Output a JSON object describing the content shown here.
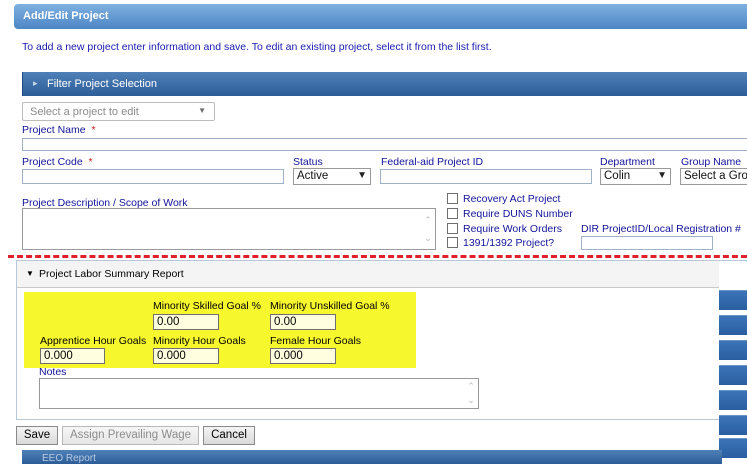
{
  "header": {
    "title": "Add/Edit Project"
  },
  "intro_text": "To add a new project enter information and save. To edit an existing project, select it from the list first.",
  "filter_bar": {
    "label": "Filter Project Selection"
  },
  "project_select": {
    "placeholder": "Select a project to edit"
  },
  "fields": {
    "project_name_label": "Project Name",
    "project_code_label": "Project Code",
    "required_mark": "*",
    "status_label": "Status",
    "status_value": "Active",
    "federal_aid_label": "Federal-aid Project ID",
    "department_label": "Department",
    "department_value": "Colin",
    "group_name_label": "Group Name",
    "group_name_value": "Select a Gro",
    "description_label": "Project Description / Scope of Work",
    "dir_label": "DIR ProjectID/Local Registration #"
  },
  "checkboxes": [
    {
      "label": "Recovery Act Project",
      "checked": false
    },
    {
      "label": "Require DUNS Number",
      "checked": false
    },
    {
      "label": "Require Work Orders",
      "checked": false
    },
    {
      "label": "1391/1392 Project?",
      "checked": false
    }
  ],
  "labor_panel": {
    "title": "Project Labor Summary Report",
    "minority_skilled_label": "Minority Skilled Goal %",
    "minority_skilled_value": "0.00",
    "minority_unskilled_label": "Minority Unskilled Goal %",
    "minority_unskilled_value": "0.00",
    "apprentice_label": "Apprentice Hour Goals",
    "apprentice_value": "0.000",
    "minority_hour_label": "Minority Hour Goals",
    "minority_hour_value": "0.000",
    "female_hour_label": "Female Hour Goals",
    "female_hour_value": "0.000",
    "notes_label": "Notes"
  },
  "buttons": {
    "save": "Save",
    "assign": "Assign Prevailing Wage",
    "cancel": "Cancel"
  },
  "bottom_bar_label": "EEO Report",
  "colors": {
    "highlight": "#f7f72e",
    "annotation_dash": "#e0202a",
    "header_blue": "#4d86c6"
  }
}
